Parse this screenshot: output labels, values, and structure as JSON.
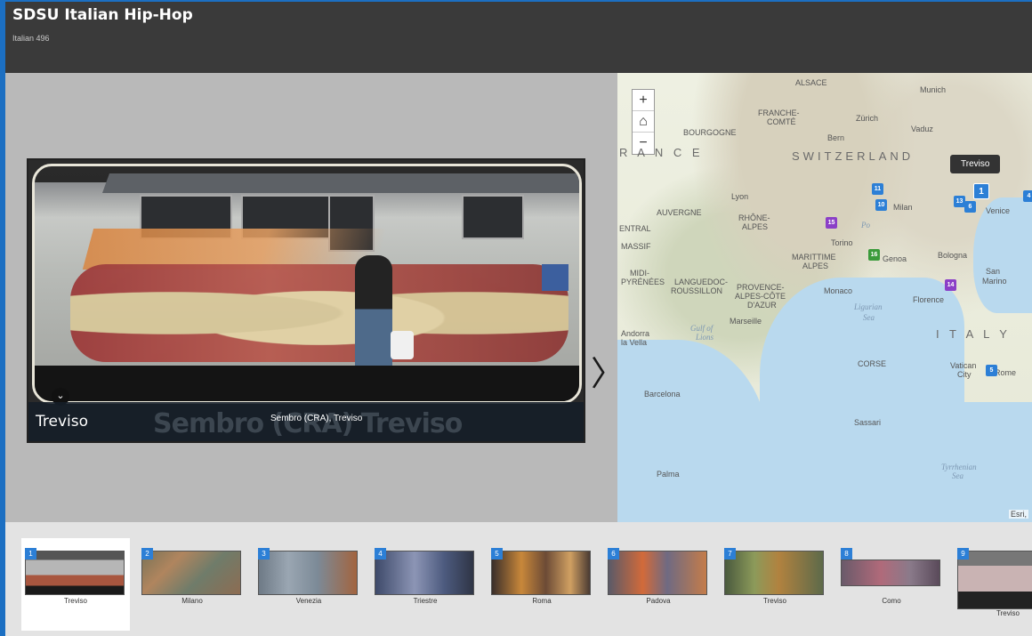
{
  "header": {
    "title": "SDSU Italian Hip-Hop",
    "subtitle": "Italian 496"
  },
  "media": {
    "title": "Treviso",
    "caption": "Sembro (CRA), Treviso",
    "photo_watermark": "Sembro (CRA) Treviso",
    "collapse_icon": "chevron-down-icon",
    "next_icon": "chevron-right-icon"
  },
  "map": {
    "tooltip": "Treviso",
    "attribution": "Esri,",
    "zoom_in": "+",
    "home": "⌂",
    "zoom_out": "−",
    "labels": [
      {
        "text": "Munich"
      },
      {
        "text": "ALSACE"
      },
      {
        "text": "FRANCHE-"
      },
      {
        "text": "COMTÉ"
      },
      {
        "text": "Zürich"
      },
      {
        "text": "Vaduz"
      },
      {
        "text": "BOURGOGNE"
      },
      {
        "text": "Bern"
      },
      {
        "text": "SWITZERLAND"
      },
      {
        "text": "R A N C E"
      },
      {
        "text": "Lyon"
      },
      {
        "text": "AUVERGNE"
      },
      {
        "text": "RHÔNE-"
      },
      {
        "text": "ALPES"
      },
      {
        "text": "ENTRAL"
      },
      {
        "text": "MASSIF"
      },
      {
        "text": "Torino"
      },
      {
        "text": "MARITTIME"
      },
      {
        "text": "ALPES"
      },
      {
        "text": "Genoa"
      },
      {
        "text": "Bologna"
      },
      {
        "text": "San"
      },
      {
        "text": "Marino"
      },
      {
        "text": "MIDI-"
      },
      {
        "text": "PYRÉNÉES"
      },
      {
        "text": "LANGUEDOC-"
      },
      {
        "text": "ROUSSILLON"
      },
      {
        "text": "PROVENCE-"
      },
      {
        "text": "ALPES-CÔTE"
      },
      {
        "text": "D'AZUR"
      },
      {
        "text": "Monaco"
      },
      {
        "text": "Florence"
      },
      {
        "text": "Marseille"
      },
      {
        "text": "Ligurian"
      },
      {
        "text": "Sea"
      },
      {
        "text": "I T A L Y"
      },
      {
        "text": "Andorra"
      },
      {
        "text": "la Vella"
      },
      {
        "text": "Gulf of"
      },
      {
        "text": "Lions"
      },
      {
        "text": "CORSE"
      },
      {
        "text": "Vatican"
      },
      {
        "text": "City"
      },
      {
        "text": "Rome"
      },
      {
        "text": "Barcelona"
      },
      {
        "text": "Sassari"
      },
      {
        "text": "Palma"
      },
      {
        "text": "Tyrrhenian"
      },
      {
        "text": "Sea"
      },
      {
        "text": "Milan"
      },
      {
        "text": "Venice"
      },
      {
        "text": "Po"
      }
    ],
    "pins": [
      {
        "num": "1",
        "color": "blue",
        "active": true
      },
      {
        "num": "11",
        "color": "blue"
      },
      {
        "num": "10",
        "color": "blue"
      },
      {
        "num": "15",
        "color": "purple"
      },
      {
        "num": "16",
        "color": "green"
      },
      {
        "num": "13",
        "color": "blue"
      },
      {
        "num": "6",
        "color": "blue"
      },
      {
        "num": "4",
        "color": "blue"
      },
      {
        "num": "14",
        "color": "purple"
      },
      {
        "num": "5",
        "color": "blue"
      }
    ]
  },
  "thumbnails": [
    {
      "num": "1",
      "caption": "Treviso",
      "active": true
    },
    {
      "num": "2",
      "caption": "Milano"
    },
    {
      "num": "3",
      "caption": "Venezia"
    },
    {
      "num": "4",
      "caption": "Triestre"
    },
    {
      "num": "5",
      "caption": "Roma"
    },
    {
      "num": "6",
      "caption": "Padova"
    },
    {
      "num": "7",
      "caption": "Treviso"
    },
    {
      "num": "8",
      "caption": "Como"
    },
    {
      "num": "9",
      "caption": "Treviso"
    }
  ]
}
